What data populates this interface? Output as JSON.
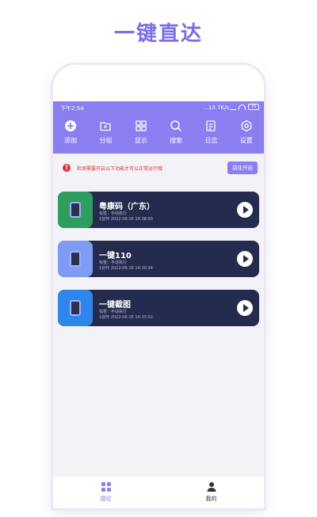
{
  "headline": "一键直达",
  "status_bar": {
    "time": "下午2:54",
    "network_speed": "...13.7K/s",
    "battery": "76"
  },
  "toolbar": [
    {
      "label": "添加",
      "icon": "plus-circle-icon"
    },
    {
      "label": "分组",
      "icon": "folder-icon"
    },
    {
      "label": "显示",
      "icon": "grid-icon"
    },
    {
      "label": "搜索",
      "icon": "search-icon"
    },
    {
      "label": "日志",
      "icon": "log-icon"
    },
    {
      "label": "设置",
      "icon": "gear-icon"
    }
  ],
  "notice": {
    "text": "检测需要开启以下功能才可以正常运行哦",
    "button": "前往开启"
  },
  "shortcuts": [
    {
      "title": "粤康码（广东）",
      "line1": "标签：手动执行",
      "line2": "1创作 2022-06-16 14:38:00",
      "accent": "#2f9d5e"
    },
    {
      "title": "一键110",
      "line1": "标签：手动执行",
      "line2": "1创作 2022-06-16 14:30:34",
      "accent": "#7f9cf5"
    },
    {
      "title": "一键截图",
      "line1": "标签：手动执行",
      "line2": "1创作 2022-06-16 14:33:52",
      "accent": "#2f86ea"
    }
  ],
  "bottom_nav": [
    {
      "label": "捷径",
      "icon": "shortcuts-icon",
      "active": true
    },
    {
      "label": "我的",
      "icon": "profile-icon",
      "active": false
    }
  ],
  "colors": {
    "brand": "#8a7ef0",
    "card": "#252a4f",
    "warning": "#e0343a"
  }
}
